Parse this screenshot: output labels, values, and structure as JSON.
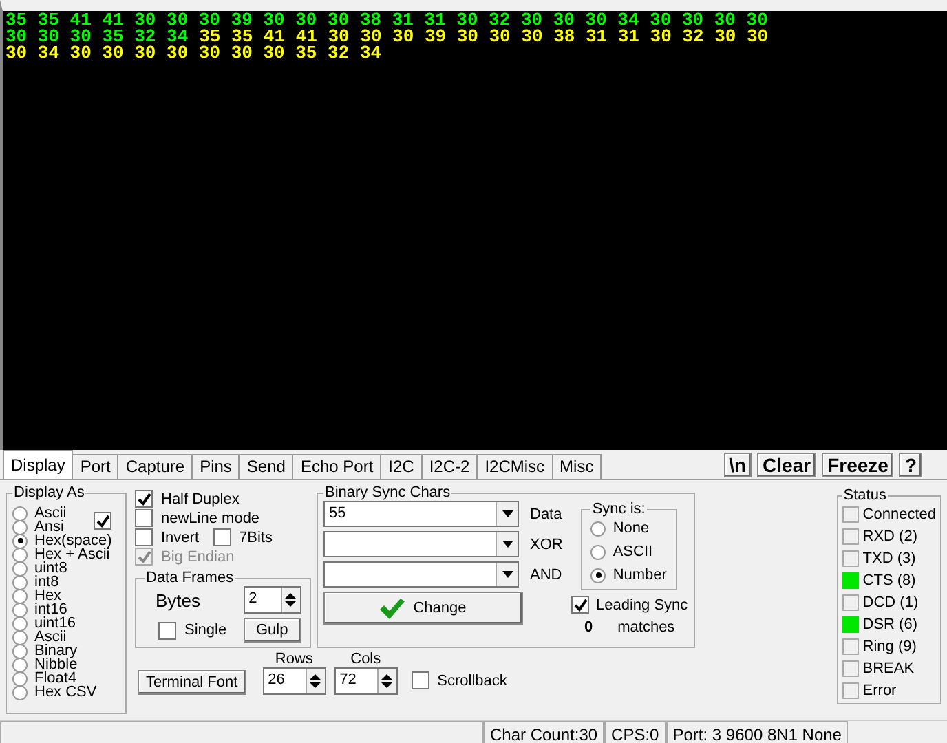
{
  "terminal": {
    "lines": [
      {
        "segments": [
          {
            "text": "35 35 41 41 30 30 30 39 30 30 30 38 31 31 30 32 30 30 30 34 30 30 30 30",
            "color": "#00ff00"
          }
        ]
      },
      {
        "segments": [
          {
            "text": "30 30 30 35 32 34",
            "color": "#00ff00"
          },
          {
            "text": "35 35 41 41 30 30 30 39 30 30 30 38 31 31 30 32 30 30",
            "color": "#ffff00"
          }
        ]
      },
      {
        "segments": [
          {
            "text": "30 34 30 30 30 30 30 30 30 35 32 34",
            "color": "#ffff00"
          }
        ]
      }
    ]
  },
  "tabs": [
    {
      "label": "Display",
      "selected": true
    },
    {
      "label": "Port",
      "selected": false
    },
    {
      "label": "Capture",
      "selected": false
    },
    {
      "label": "Pins",
      "selected": false
    },
    {
      "label": "Send",
      "selected": false
    },
    {
      "label": "Echo Port",
      "selected": false
    },
    {
      "label": "I2C",
      "selected": false
    },
    {
      "label": "I2C-2",
      "selected": false
    },
    {
      "label": "I2CMisc",
      "selected": false
    },
    {
      "label": "Misc",
      "selected": false
    }
  ],
  "toolbar_buttons": [
    "\\n",
    "Clear",
    "Freeze",
    "?"
  ],
  "display_as": {
    "title": "Display As",
    "checked": true,
    "options": [
      {
        "label": "Ascii",
        "selected": false
      },
      {
        "label": "Ansi",
        "selected": false
      },
      {
        "label": "Hex(space)",
        "selected": true
      },
      {
        "label": "Hex + Ascii",
        "selected": false
      },
      {
        "label": "uint8",
        "selected": false
      },
      {
        "label": "int8",
        "selected": false
      },
      {
        "label": "Hex",
        "selected": false
      },
      {
        "label": "int16",
        "selected": false
      },
      {
        "label": "uint16",
        "selected": false
      },
      {
        "label": "Ascii",
        "selected": false
      },
      {
        "label": "Binary",
        "selected": false
      },
      {
        "label": "Nibble",
        "selected": false
      },
      {
        "label": "Float4",
        "selected": false
      },
      {
        "label": "Hex CSV",
        "selected": false
      }
    ]
  },
  "option_rows": [
    {
      "items": [
        {
          "label": "Half Duplex",
          "checked": true,
          "disabled": false
        }
      ]
    },
    {
      "items": [
        {
          "label": "newLine mode",
          "checked": false,
          "disabled": false
        }
      ]
    },
    {
      "items": [
        {
          "label": "Invert",
          "checked": false,
          "disabled": false
        },
        {
          "label": "7Bits",
          "checked": false,
          "disabled": false
        }
      ]
    },
    {
      "items": [
        {
          "label": "Big Endian",
          "checked": true,
          "disabled": true
        }
      ]
    }
  ],
  "data_frames": {
    "title": "Data Frames",
    "bytes_label": "Bytes",
    "bytes_value": "2",
    "single": {
      "label": "Single",
      "checked": false
    },
    "gulp_button": "Gulp"
  },
  "binary_sync": {
    "title": "Binary Sync Chars",
    "fields": [
      {
        "value": "55",
        "label": "Data"
      },
      {
        "label": "XOR"
      },
      {
        "label": "AND"
      }
    ],
    "change_button": "Change",
    "sync_is": {
      "title": "Sync is:",
      "options": [
        {
          "label": "None",
          "selected": false
        },
        {
          "label": "ASCII",
          "selected": false
        },
        {
          "label": "Number",
          "selected": true
        }
      ]
    },
    "leading_sync": {
      "label": "Leading Sync",
      "checked": true
    },
    "match_count": "0",
    "matches_label": "matches"
  },
  "terminal_font_button": "Terminal Font",
  "rows": {
    "label": "Rows",
    "value": "26"
  },
  "cols": {
    "label": "Cols",
    "value": "72"
  },
  "scrollback": {
    "label": "Scrollback",
    "checked": false
  },
  "status": {
    "title": "Status",
    "items": [
      {
        "label": "Connected",
        "on": false
      },
      {
        "label": "RXD (2)",
        "on": false
      },
      {
        "label": "TXD (3)",
        "on": false
      },
      {
        "label": "CTS (8)",
        "on": true
      },
      {
        "label": "DCD (1)",
        "on": false
      },
      {
        "label": "DSR (6)",
        "on": true
      },
      {
        "label": "Ring (9)",
        "on": false
      },
      {
        "label": "BREAK",
        "on": false
      },
      {
        "label": "Error",
        "on": false
      }
    ]
  },
  "status_bar": [
    "Char Count:30",
    "CPS:0",
    "Port: 3 9600 8N1 None"
  ]
}
